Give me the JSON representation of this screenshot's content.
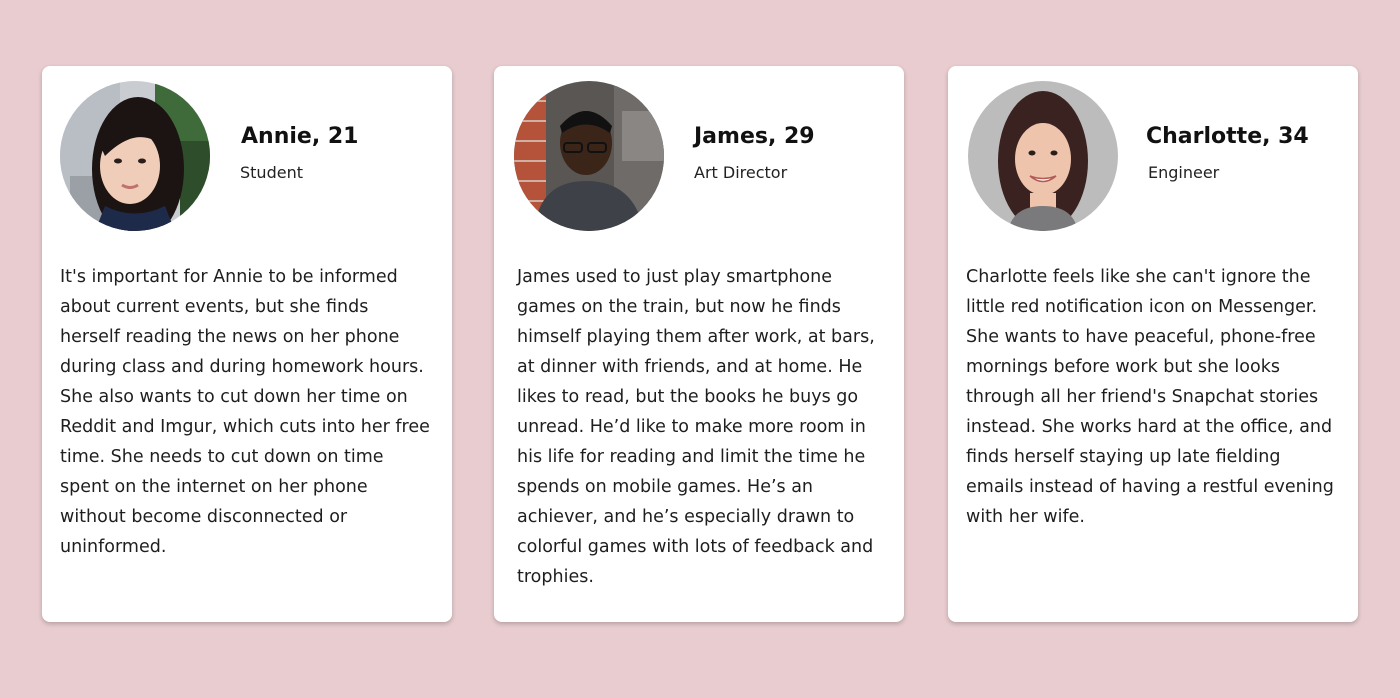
{
  "personas": [
    {
      "name": "Annie, 21",
      "role": "Student",
      "avatar_icon": "photo-woman-long-dark-hair",
      "bio": "It's important for Annie to be informed about current events, but she finds herself reading the news on her phone during class and during homework hours. She also wants to cut down her time on Reddit and Imgur, which cuts into her free time. She needs to cut down on time spent on the internet on her phone without become disconnected or uninformed."
    },
    {
      "name": "James, 29",
      "role": "Art Director",
      "avatar_icon": "photo-man-glasses-looking-down",
      "bio": "James used to just play smartphone games on the train, but now he finds himself playing them after work, at bars, at dinner with friends, and at home. He likes to read, but the books he buys go unread. He’d like to make more room in his life for reading and limit the time he spends on mobile games. He’s an achiever, and he’s especially drawn to colorful games with lots of feedback and trophies."
    },
    {
      "name": "Charlotte, 34",
      "role": "Engineer",
      "avatar_icon": "photo-woman-smiling-gray-background",
      "bio": "Charlotte feels like she can't ignore the little red notification icon on Messenger. She wants to have peaceful, phone-free mornings before work but she looks through all her friend's Snapchat stories instead. She works hard at the office, and finds herself staying up late fielding emails instead of having a restful evening with her wife."
    }
  ],
  "colors": {
    "background": "#e8cccf",
    "card": "#ffffff",
    "text": "#1e1e1e"
  }
}
